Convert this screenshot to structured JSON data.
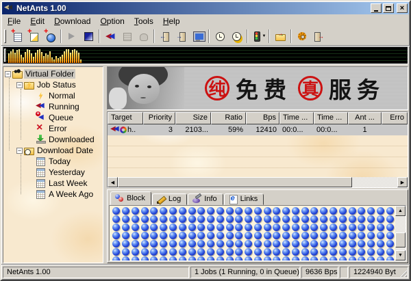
{
  "window": {
    "title": "NetAnts 1.00"
  },
  "titlebar_controls": [
    {
      "name": "minimize"
    },
    {
      "name": "maximize"
    },
    {
      "name": "close"
    }
  ],
  "menu": {
    "items": [
      {
        "label": "File",
        "mnemonic": 0
      },
      {
        "label": "Edit",
        "mnemonic": 0
      },
      {
        "label": "Download",
        "mnemonic": 0
      },
      {
        "label": "Option",
        "mnemonic": 0
      },
      {
        "label": "Tools",
        "mnemonic": 0
      },
      {
        "label": "Help",
        "mnemonic": 0
      }
    ]
  },
  "toolbar": {
    "buttons": [
      {
        "name": "add-job",
        "icon": "doc-plus"
      },
      {
        "name": "add-batch",
        "icon": "notepad-plus"
      },
      {
        "name": "add-url",
        "icon": "globe-plus"
      },
      {
        "separator": true
      },
      {
        "name": "start",
        "icon": "play"
      },
      {
        "name": "stop",
        "icon": "stop"
      },
      {
        "separator": true
      },
      {
        "name": "resume-ant",
        "icon": "ant-plus"
      },
      {
        "name": "properties",
        "icon": "gray-doc",
        "disabled": true
      },
      {
        "name": "delete",
        "icon": "gray-hand",
        "disabled": true
      },
      {
        "separator": true
      },
      {
        "name": "import",
        "icon": "door-in"
      },
      {
        "name": "export",
        "icon": "door-out"
      },
      {
        "name": "browser",
        "icon": "monitor"
      },
      {
        "separator": true
      },
      {
        "name": "history",
        "icon": "clock"
      },
      {
        "name": "schedule",
        "icon": "clock-coins"
      },
      {
        "separator": true
      },
      {
        "name": "traffic-limit",
        "icon": "traffic-light",
        "dropdown": true
      },
      {
        "separator": true
      },
      {
        "name": "drop-basket",
        "icon": "folder-arrows"
      },
      {
        "separator": true
      },
      {
        "name": "options",
        "icon": "gear"
      },
      {
        "name": "exit",
        "icon": "exit-door"
      }
    ]
  },
  "speed_graph": {
    "max": 22,
    "bars": [
      15,
      19,
      22,
      17,
      21,
      22,
      13,
      9,
      18,
      22,
      21,
      15,
      10,
      16,
      21,
      22,
      18,
      11,
      15,
      13,
      19,
      9,
      6,
      11,
      8,
      10,
      13,
      19,
      22,
      22,
      17,
      21,
      22,
      20,
      16,
      5
    ]
  },
  "sidebar": {
    "items": [
      {
        "label": "Virtual Folder",
        "depth": 0,
        "expander": "minus",
        "icon": "ant-folder",
        "selected": true
      },
      {
        "label": "Job Status",
        "depth": 1,
        "expander": "minus",
        "icon": "folder-lightning"
      },
      {
        "label": "Normal",
        "depth": 2,
        "icon": "lightning"
      },
      {
        "label": "Running",
        "depth": 2,
        "icon": "arrows-running"
      },
      {
        "label": "Queue",
        "depth": 2,
        "icon": "arrows-queue"
      },
      {
        "label": "Error",
        "depth": 2,
        "icon": "error-x"
      },
      {
        "label": "Downloaded",
        "depth": 2,
        "icon": "down-arrow"
      },
      {
        "label": "Download Date",
        "depth": 1,
        "expander": "minus",
        "icon": "folder-clock"
      },
      {
        "label": "Today",
        "depth": 2,
        "icon": "calendar"
      },
      {
        "label": "Yesterday",
        "depth": 2,
        "icon": "calendar"
      },
      {
        "label": "Last Week",
        "depth": 2,
        "icon": "calendar"
      },
      {
        "label": "A Week Ago",
        "depth": 2,
        "icon": "calendar"
      }
    ]
  },
  "banner": {
    "segments": [
      {
        "text": "纯",
        "style": "circle"
      },
      {
        "text": "免费",
        "style": "plain"
      },
      {
        "text": "真",
        "style": "circle"
      },
      {
        "text": "服务",
        "style": "plain"
      }
    ]
  },
  "job_table": {
    "columns": [
      {
        "label": "Target",
        "width": 52,
        "align": "left"
      },
      {
        "label": "Priority",
        "width": 47,
        "align": "right"
      },
      {
        "label": "Size",
        "width": 52,
        "align": "right"
      },
      {
        "label": "Ratio",
        "width": 51,
        "align": "right"
      },
      {
        "label": "Bps",
        "width": 49,
        "align": "right"
      },
      {
        "label": "Time ...",
        "width": 50,
        "align": "left"
      },
      {
        "label": "Time ...",
        "width": 50,
        "align": "left"
      },
      {
        "label": "Ant ...",
        "width": 49,
        "align": "center"
      },
      {
        "label": "Erro",
        "width": 40,
        "align": "right"
      }
    ],
    "rows": [
      {
        "selected": true,
        "cells": [
          "h..",
          "3",
          "2103...",
          "59%",
          "12410",
          "00:0...",
          "00:0...",
          "1",
          ""
        ]
      }
    ]
  },
  "tabs": {
    "items": [
      {
        "label": "Block",
        "icon": "balls",
        "active": true
      },
      {
        "label": "Log",
        "icon": "pencil",
        "active": false
      },
      {
        "label": "Info",
        "icon": "ink",
        "active": false
      },
      {
        "label": "Links",
        "icon": "e-page",
        "active": false
      }
    ]
  },
  "block_grid": {
    "rows": 7,
    "cols": 30,
    "total_visible": 210
  },
  "status_bar": {
    "panels": [
      {
        "text": "NetAnts 1.00",
        "flex": true
      },
      {
        "text": "1 Jobs (1 Running, 0 in Queue)",
        "width": 160
      },
      {
        "text": "9636 Bps",
        "width": 54
      },
      {
        "text": "",
        "width": 10
      },
      {
        "text": "1224940 Byt",
        "width": 86,
        "grip": true
      }
    ]
  },
  "colors": {
    "titlebar_start": "#0a246a",
    "titlebar_end": "#a6caf0",
    "chrome": "#d4d0c8",
    "panel_texture": "#f8e9cf",
    "block_sphere": "#2547d8",
    "banner_red": "#cc1111",
    "graph_bar": "#ffaa22"
  }
}
